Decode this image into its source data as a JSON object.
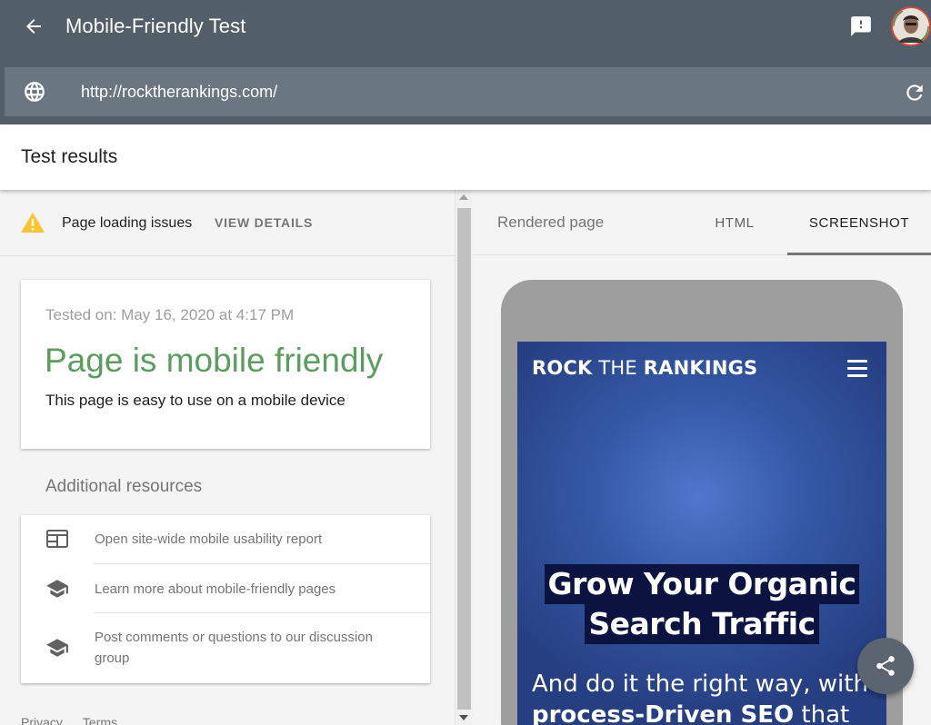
{
  "app": {
    "title": "Mobile-Friendly Test",
    "back_icon": "arrow-back-icon",
    "feedback_icon": "feedback-icon",
    "avatar_icon": "user-avatar"
  },
  "urlbar": {
    "value": "http://rocktherankings.com/",
    "globe_icon": "globe-icon",
    "reload_icon": "reload-icon"
  },
  "results": {
    "title": "Test results"
  },
  "issues": {
    "label": "Page loading issues",
    "action": "VIEW DETAILS",
    "icon": "warning-icon",
    "icon_color": "#f9c42c"
  },
  "verdict": {
    "tested_on": "Tested on: May 16, 2020 at 4:17 PM",
    "headline": "Page is mobile friendly",
    "description": "This page is easy to use on a mobile device",
    "color": "#5a9e5e"
  },
  "resources": {
    "title": "Additional resources",
    "items": [
      {
        "label": "Open site-wide mobile usability report",
        "icon": "web-report-icon"
      },
      {
        "label": "Learn more about mobile-friendly pages",
        "icon": "school-icon"
      },
      {
        "label": "Post comments or questions to our discussion group",
        "icon": "school-icon"
      }
    ]
  },
  "footer": {
    "links": [
      "Privacy",
      "Terms"
    ]
  },
  "preview": {
    "rendered_label": "Rendered page",
    "tabs": [
      "HTML",
      "SCREENSHOT"
    ],
    "active_tab": "SCREENSHOT"
  },
  "screenshot": {
    "brand_bold_1": "ROCK",
    "brand_thin": " THE ",
    "brand_bold_2": "RANKINGS",
    "headline_line1": "Grow Your Organic",
    "headline_line2": "Search Traffic",
    "sub_line1": "And do it the right way, with",
    "sub_line2_bold": "process-Driven SEO",
    "sub_line2_rest": " that",
    "menu_icon": "hamburger-menu-icon"
  },
  "fab": {
    "icon": "share-icon"
  }
}
